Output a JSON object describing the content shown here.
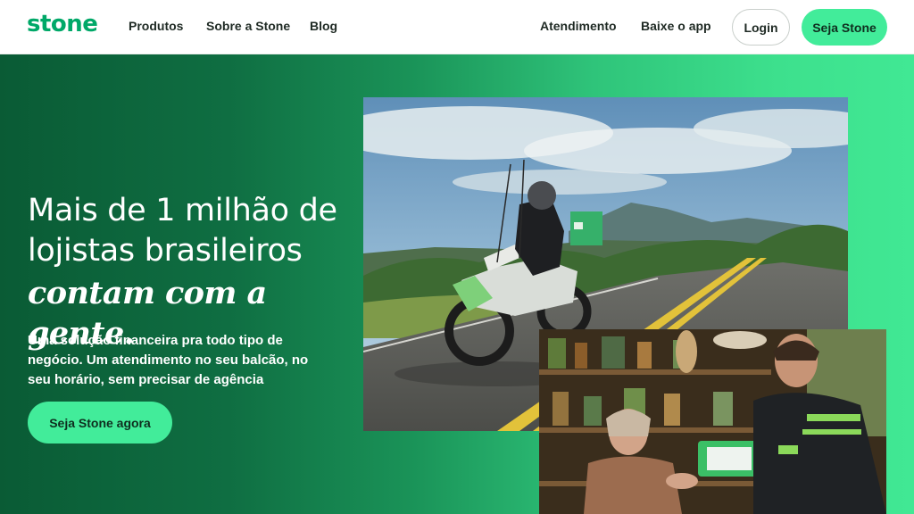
{
  "header": {
    "logo": "stone",
    "nav_left": [
      "Produtos",
      "Sobre a Stone",
      "Blog"
    ],
    "nav_right": [
      "Atendimento",
      "Baixe o app"
    ],
    "login_label": "Login",
    "cta_label": "Seja Stone"
  },
  "hero": {
    "headline_line1": "Mais de 1 milhão de",
    "headline_line2": "lojistas brasileiros",
    "headline_line3": "contam com a gente.",
    "subtext": "Uma solução financeira pra todo tipo de negócio. Um atendimento no seu balcão, no seu horário, sem precisar de agência",
    "cta_label": "Seja Stone agora"
  },
  "colors": {
    "brand_green": "#00a868",
    "accent_mint": "#42ec9a",
    "hero_dark": "#0a5b35"
  }
}
